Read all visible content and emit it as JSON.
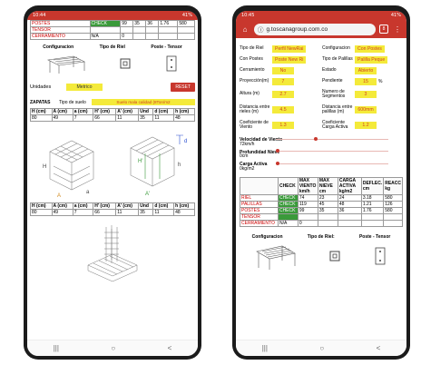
{
  "left": {
    "status": {
      "time": "10:44",
      "right": "41%"
    },
    "top_table": [
      [
        "POSTES",
        "CHECK",
        "99",
        "35",
        "36",
        "1.76",
        "580"
      ],
      [
        "TENSOR",
        "",
        "",
        "",
        "",
        "",
        ""
      ],
      [
        "CERRAMIENTO",
        "N/A",
        "0",
        "",
        "",
        "",
        ""
      ]
    ],
    "labels": {
      "config": "Configuracion",
      "riel": "Tipo de Riel",
      "poste": "Poste - Tensor"
    },
    "unidades": {
      "label": "Unidades",
      "value": "Metrico",
      "reset": "RESET"
    },
    "zapatas": {
      "label": "ZAPATAS",
      "suelo_label": "Tipo de suelo",
      "suelo_value": "Suelo mala calidad (8Ton/m2"
    },
    "table_headers": [
      "H (cm)",
      "A (cm)",
      "a (cm)",
      "H' (cm)",
      "A' (cm)",
      "Und",
      "d (cm)",
      "h (cm)"
    ],
    "table_row": [
      "80",
      "49",
      "7",
      "66",
      "11",
      "35",
      "11",
      "48",
      "48"
    ],
    "diagram_labels": {
      "H": "H",
      "A": "A",
      "a": "a",
      "Hp": "H'",
      "Ap": "A'",
      "d": "d",
      "h": "h"
    },
    "colors": {
      "accent": "#c8372d",
      "yellow": "#f4ea3a",
      "check": "#3a9a3a"
    }
  },
  "right": {
    "status": {
      "time": "10:45",
      "right": "41%"
    },
    "url": "g.toscanagroup.com.co",
    "tab_count": "8",
    "fields_left": [
      {
        "label": "Tipo de Riel",
        "value": "Perfil NewRai"
      },
      {
        "label": "Con Postes",
        "value": "Poste New Ri"
      },
      {
        "label": "Cerramiento",
        "value": "No"
      },
      {
        "label": "Proyección(m)",
        "value": "7"
      },
      {
        "label": "Altura (m)",
        "value": "2.7"
      },
      {
        "label": "Distancia entre rieles (m)",
        "value": "4.5"
      },
      {
        "label": "Coeficiente de Viento",
        "value": "1.3"
      }
    ],
    "fields_right": [
      {
        "label": "Configuracion",
        "value": "Con Postes"
      },
      {
        "label": "Tipo de Palillas",
        "value": "Palilla Peque"
      },
      {
        "label": "Estado",
        "value": "Abierto"
      },
      {
        "label": "Pendiente",
        "value": "15",
        "unit": "%"
      },
      {
        "label": "Numero de Segmentos",
        "value": "3"
      },
      {
        "label": "Distancia entre palillas (m)",
        "value": "600mm"
      },
      {
        "label": "Coeficiente Carga Activa",
        "value": "1.2"
      }
    ],
    "sliders": [
      {
        "title": "Velocidad de Viento",
        "value": "72km/h",
        "level": 0.55
      },
      {
        "title": "Profundidad Nieve",
        "value": "0cm",
        "level": 0.0
      },
      {
        "title": "Carga Activa",
        "value": "0kg/m2",
        "level": 0.0
      }
    ],
    "results_headers": [
      "",
      "CHECK",
      "MAX VIENTO km/h",
      "MAX NIEVE cm",
      "CARGA ACTIVA kg/m2",
      "DEFLEC. cm",
      "REACC kg"
    ],
    "results": [
      [
        "RIEL",
        "CHECK",
        "74",
        "23",
        "24",
        "3.18",
        "580"
      ],
      [
        "PALILLAS",
        "CHECK",
        "119",
        "45",
        "48",
        "1.21",
        "126"
      ],
      [
        "POSTES",
        "CHECK",
        "99",
        "35",
        "36",
        "1.76",
        "580"
      ],
      [
        "TENSOR",
        "",
        "",
        "",
        "",
        "",
        ""
      ],
      [
        "CERRAMIENTO",
        "N/A",
        "0",
        "",
        "",
        "",
        ""
      ]
    ],
    "labels": {
      "config": "Configuracion",
      "riel": "Tipo de Riel:",
      "poste": "Poste - Tensor"
    }
  },
  "nav": {
    "recent": "|||",
    "home": "○",
    "back": "<"
  }
}
